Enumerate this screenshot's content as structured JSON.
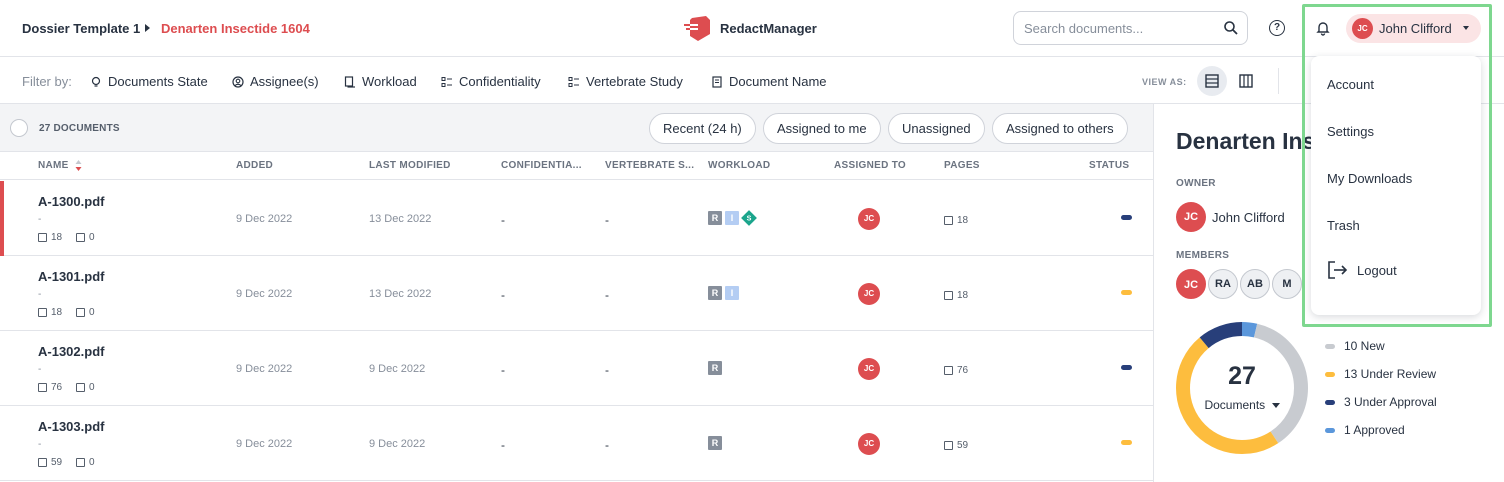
{
  "header": {
    "breadcrumb": {
      "parent": "Dossier Template 1",
      "current": "Denarten Insectide 1604"
    },
    "brand": "RedactManager",
    "search_placeholder": "Search documents...",
    "help_glyph": "?",
    "user": {
      "initials": "JC",
      "name": "John Clifford"
    }
  },
  "filters": {
    "label": "Filter by:",
    "items": [
      {
        "label": "Documents State",
        "icon": "lightbulb-icon"
      },
      {
        "label": "Assignee(s)",
        "icon": "user-circle-icon"
      },
      {
        "label": "Workload",
        "icon": "workload-icon"
      },
      {
        "label": "Confidentiality",
        "icon": "list-icon"
      },
      {
        "label": "Vertebrate Study",
        "icon": "list-icon"
      },
      {
        "label": "Document Name",
        "icon": "document-icon"
      }
    ],
    "view_as": "VIEW AS:"
  },
  "list": {
    "count_label": "27 DOCUMENTS",
    "quick_filters": [
      "Recent (24 h)",
      "Assigned to me",
      "Unassigned",
      "Assigned to others"
    ],
    "columns": [
      "NAME",
      "ADDED",
      "LAST MODIFIED",
      "CONFIDENTIA...",
      "VERTEBRATE S...",
      "WORKLOAD",
      "ASSIGNED TO",
      "PAGES",
      "STATUS"
    ],
    "rows": [
      {
        "name": "A-1300.pdf",
        "sub": "-",
        "pages_meta": "18",
        "annotations": "0",
        "added": "9 Dec 2022",
        "modified": "13 Dec 2022",
        "confidentiality": "-",
        "vertebrate": "-",
        "workload": [
          "R",
          "I",
          "S"
        ],
        "assignee": "JC",
        "pages": "18",
        "status_color": "#283f7a"
      },
      {
        "name": "A-1301.pdf",
        "sub": "-",
        "pages_meta": "18",
        "annotations": "0",
        "added": "9 Dec 2022",
        "modified": "13 Dec 2022",
        "confidentiality": "-",
        "vertebrate": "-",
        "workload": [
          "R",
          "I"
        ],
        "assignee": "JC",
        "pages": "18",
        "status_color": "#fdbd3e"
      },
      {
        "name": "A-1302.pdf",
        "sub": "-",
        "pages_meta": "76",
        "annotations": "0",
        "added": "9 Dec 2022",
        "modified": "9 Dec 2022",
        "confidentiality": "-",
        "vertebrate": "-",
        "workload": [
          "R"
        ],
        "assignee": "JC",
        "pages": "76",
        "status_color": "#283f7a"
      },
      {
        "name": "A-1303.pdf",
        "sub": "-",
        "pages_meta": "59",
        "annotations": "0",
        "added": "9 Dec 2022",
        "modified": "9 Dec 2022",
        "confidentiality": "-",
        "vertebrate": "-",
        "workload": [
          "R"
        ],
        "assignee": "JC",
        "pages": "59",
        "status_color": "#fdbd3e"
      }
    ]
  },
  "details": {
    "title": "Denarten Ins",
    "owner_label": "OWNER",
    "owner": {
      "initials": "JC",
      "name": "John Clifford"
    },
    "members_label": "MEMBERS",
    "members": [
      "JC",
      "RA",
      "AB",
      "M"
    ],
    "total": "27",
    "total_label": "Documents",
    "legend": [
      {
        "label": "10 New",
        "value": 10,
        "color": "#c8cbd0"
      },
      {
        "label": "13 Under Review",
        "value": 13,
        "color": "#fdbd3e"
      },
      {
        "label": "3 Under Approval",
        "value": 3,
        "color": "#283f7a"
      },
      {
        "label": "1 Approved",
        "value": 1,
        "color": "#5b97db"
      }
    ]
  },
  "user_menu": {
    "items": [
      "Account",
      "Settings",
      "My Downloads",
      "Trash"
    ],
    "logout": "Logout"
  },
  "colors": {
    "brand_red": "#dd4d50",
    "highlight": "#7ed78f"
  }
}
